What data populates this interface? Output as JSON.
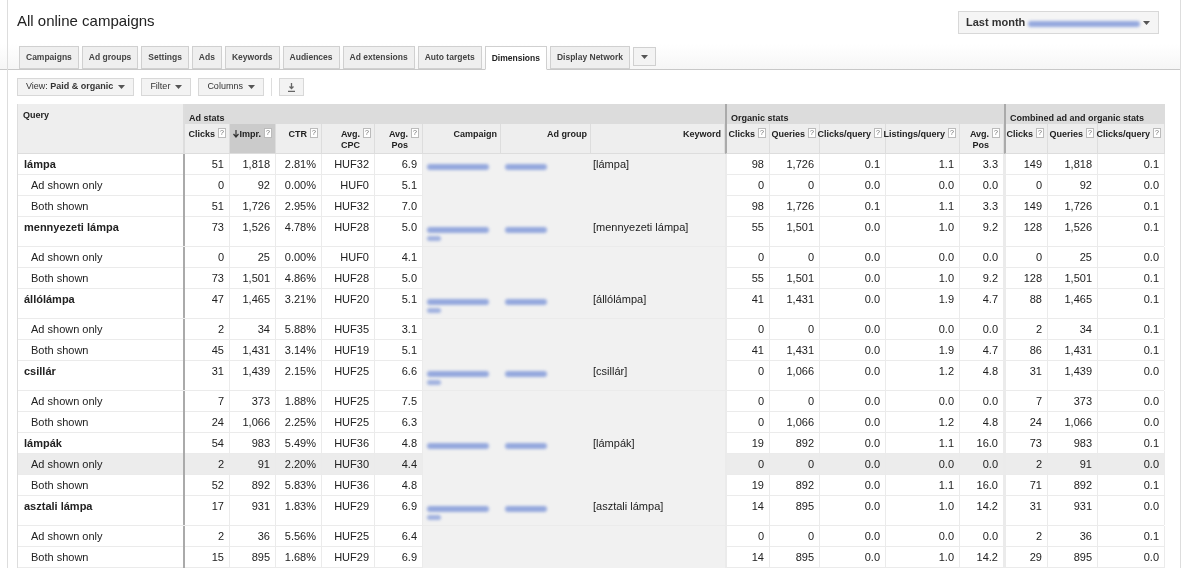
{
  "page": {
    "title": "All online campaigns"
  },
  "date_range": {
    "label": "Last month"
  },
  "tabs": [
    {
      "label": "Campaigns",
      "selected": false
    },
    {
      "label": "Ad groups",
      "selected": false
    },
    {
      "label": "Settings",
      "selected": false
    },
    {
      "label": "Ads",
      "selected": false
    },
    {
      "label": "Keywords",
      "selected": false
    },
    {
      "label": "Audiences",
      "selected": false
    },
    {
      "label": "Ad extensions",
      "selected": false
    },
    {
      "label": "Auto targets",
      "selected": false
    },
    {
      "label": "Dimensions",
      "selected": true
    },
    {
      "label": "Display Network",
      "selected": false
    }
  ],
  "toolbar": [
    {
      "kind": "dropdown",
      "label": "View: ",
      "value": "Paid & organic"
    },
    {
      "kind": "dropdown",
      "label": "Filter"
    },
    {
      "kind": "dropdown",
      "label": "Columns"
    },
    {
      "kind": "download"
    }
  ],
  "table": {
    "query_column": {
      "label": "Query"
    },
    "groups": [
      {
        "label": "Ad stats",
        "columns": [
          {
            "label": "Clicks",
            "help": "?",
            "kind": "number",
            "sorted": false
          },
          {
            "label": "Impr.",
            "help": "?",
            "kind": "number",
            "sorted": true
          },
          {
            "label": "CTR",
            "help": "?",
            "kind": "number",
            "sorted": false
          },
          {
            "label": "Avg. CPC",
            "help": "?",
            "kind": "number",
            "sorted": false
          },
          {
            "label": "Avg. Pos",
            "help": "?",
            "kind": "number",
            "sorted": false
          },
          {
            "label": "Campaign",
            "kind": "redacted",
            "sorted": false
          },
          {
            "label": "Ad group",
            "kind": "redacted",
            "sorted": false
          },
          {
            "label": "Keyword",
            "kind": "keyword",
            "sorted": false
          }
        ]
      },
      {
        "label": "Organic stats",
        "columns": [
          {
            "label": "Clicks",
            "help": "?",
            "kind": "number",
            "sorted": false
          },
          {
            "label": "Queries",
            "help": "?",
            "kind": "number",
            "sorted": false
          },
          {
            "label": "Clicks/query",
            "help": "?",
            "kind": "number",
            "sorted": false
          },
          {
            "label": "Listings/query",
            "help": "?",
            "kind": "number",
            "sorted": false
          },
          {
            "label": "Avg. Pos",
            "help": "?",
            "kind": "number",
            "sorted": false
          }
        ]
      },
      {
        "label": "Combined ad and organic stats",
        "columns": [
          {
            "label": "Clicks",
            "help": "?",
            "kind": "number",
            "sorted": false
          },
          {
            "label": "Queries",
            "help": "?",
            "kind": "number",
            "sorted": false
          },
          {
            "label": "Clicks/query",
            "help": "?",
            "kind": "number",
            "sorted": false
          }
        ]
      }
    ],
    "rows": [
      {
        "query": "lámpa",
        "keyword": "[lámpa]",
        "values": [
          "51",
          "1,818",
          "2.81%",
          "HUF32",
          "6.9",
          "98",
          "1,726",
          "0.1",
          "1.1",
          "3.3",
          "149",
          "1,818",
          "0.1"
        ],
        "children": [
          {
            "query": "Ad shown only",
            "hovered": false,
            "values": [
              "0",
              "92",
              "0.00%",
              "HUF0",
              "5.1",
              "0",
              "0",
              "0.0",
              "0.0",
              "0.0",
              "0",
              "92",
              "0.0"
            ]
          },
          {
            "query": "Both shown",
            "hovered": false,
            "values": [
              "51",
              "1,726",
              "2.95%",
              "HUF32",
              "7.0",
              "98",
              "1,726",
              "0.1",
              "1.1",
              "3.3",
              "149",
              "1,726",
              "0.1"
            ]
          }
        ]
      },
      {
        "query": "mennyezeti lámpa",
        "keyword": "[mennyezeti lámpa]",
        "values": [
          "73",
          "1,526",
          "4.78%",
          "HUF28",
          "5.0",
          "55",
          "1,501",
          "0.0",
          "1.0",
          "9.2",
          "128",
          "1,526",
          "0.1"
        ],
        "children": [
          {
            "query": "Ad shown only",
            "hovered": false,
            "values": [
              "0",
              "25",
              "0.00%",
              "HUF0",
              "4.1",
              "0",
              "0",
              "0.0",
              "0.0",
              "0.0",
              "0",
              "25",
              "0.0"
            ]
          },
          {
            "query": "Both shown",
            "hovered": false,
            "values": [
              "73",
              "1,501",
              "4.86%",
              "HUF28",
              "5.0",
              "55",
              "1,501",
              "0.0",
              "1.0",
              "9.2",
              "128",
              "1,501",
              "0.1"
            ]
          }
        ]
      },
      {
        "query": "állólámpa",
        "keyword": "[állólámpa]",
        "values": [
          "47",
          "1,465",
          "3.21%",
          "HUF20",
          "5.1",
          "41",
          "1,431",
          "0.0",
          "1.9",
          "4.7",
          "88",
          "1,465",
          "0.1"
        ],
        "children": [
          {
            "query": "Ad shown only",
            "hovered": false,
            "values": [
              "2",
              "34",
              "5.88%",
              "HUF35",
              "3.1",
              "0",
              "0",
              "0.0",
              "0.0",
              "0.0",
              "2",
              "34",
              "0.1"
            ]
          },
          {
            "query": "Both shown",
            "hovered": false,
            "values": [
              "45",
              "1,431",
              "3.14%",
              "HUF19",
              "5.1",
              "41",
              "1,431",
              "0.0",
              "1.9",
              "4.7",
              "86",
              "1,431",
              "0.1"
            ]
          }
        ]
      },
      {
        "query": "csillár",
        "keyword": "[csillár]",
        "values": [
          "31",
          "1,439",
          "2.15%",
          "HUF25",
          "6.6",
          "0",
          "1,066",
          "0.0",
          "1.2",
          "4.8",
          "31",
          "1,439",
          "0.0"
        ],
        "children": [
          {
            "query": "Ad shown only",
            "hovered": false,
            "values": [
              "7",
              "373",
              "1.88%",
              "HUF25",
              "7.5",
              "0",
              "0",
              "0.0",
              "0.0",
              "0.0",
              "7",
              "373",
              "0.0"
            ]
          },
          {
            "query": "Both shown",
            "hovered": false,
            "values": [
              "24",
              "1,066",
              "2.25%",
              "HUF25",
              "6.3",
              "0",
              "1,066",
              "0.0",
              "1.2",
              "4.8",
              "24",
              "1,066",
              "0.0"
            ]
          }
        ]
      },
      {
        "query": "lámpák",
        "keyword": "[lámpák]",
        "values": [
          "54",
          "983",
          "5.49%",
          "HUF36",
          "4.8",
          "19",
          "892",
          "0.0",
          "1.1",
          "16.0",
          "73",
          "983",
          "0.1"
        ],
        "children": [
          {
            "query": "Ad shown only",
            "hovered": true,
            "values": [
              "2",
              "91",
              "2.20%",
              "HUF30",
              "4.4",
              "0",
              "0",
              "0.0",
              "0.0",
              "0.0",
              "2",
              "91",
              "0.0"
            ]
          },
          {
            "query": "Both shown",
            "hovered": false,
            "values": [
              "52",
              "892",
              "5.83%",
              "HUF36",
              "4.8",
              "19",
              "892",
              "0.0",
              "1.1",
              "16.0",
              "71",
              "892",
              "0.1"
            ]
          }
        ]
      },
      {
        "query": "asztali lámpa",
        "keyword": "[asztali lámpa]",
        "values": [
          "17",
          "931",
          "1.83%",
          "HUF29",
          "6.9",
          "14",
          "895",
          "0.0",
          "1.0",
          "14.2",
          "31",
          "931",
          "0.0"
        ],
        "children": [
          {
            "query": "Ad shown only",
            "hovered": false,
            "values": [
              "2",
              "36",
              "5.56%",
              "HUF25",
              "6.4",
              "0",
              "0",
              "0.0",
              "0.0",
              "0.0",
              "2",
              "36",
              "0.1"
            ]
          },
          {
            "query": "Both shown",
            "hovered": false,
            "values": [
              "15",
              "895",
              "1.68%",
              "HUF29",
              "6.9",
              "14",
              "895",
              "0.0",
              "1.0",
              "14.2",
              "29",
              "895",
              "0.0"
            ]
          }
        ]
      }
    ]
  }
}
